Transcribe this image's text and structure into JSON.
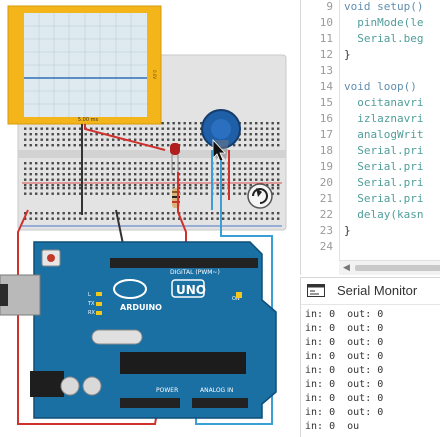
{
  "editor": {
    "lines": [
      {
        "num": "9",
        "text": "void setup()",
        "type": "kw"
      },
      {
        "num": "10",
        "text": "  pinMode(le",
        "type": "fn"
      },
      {
        "num": "11",
        "text": "  Serial.beg",
        "type": "fn"
      },
      {
        "num": "12",
        "text": "}",
        "type": "plain"
      },
      {
        "num": "13",
        "text": "",
        "type": "plain"
      },
      {
        "num": "14",
        "text": "void loop()",
        "type": "kw"
      },
      {
        "num": "15",
        "text": "  ocitanavri",
        "type": "fn"
      },
      {
        "num": "16",
        "text": "  izlaznavri",
        "type": "fn"
      },
      {
        "num": "17",
        "text": "  analogWrit",
        "type": "fn"
      },
      {
        "num": "18",
        "text": "  Serial.pri",
        "type": "fn"
      },
      {
        "num": "19",
        "text": "  Serial.pri",
        "type": "fn"
      },
      {
        "num": "20",
        "text": "  Serial.pri",
        "type": "fn"
      },
      {
        "num": "21",
        "text": "  Serial.pri",
        "type": "fn"
      },
      {
        "num": "22",
        "text": "  delay(kasn",
        "type": "fn"
      },
      {
        "num": "23",
        "text": "}",
        "type": "plain"
      },
      {
        "num": "24",
        "text": "",
        "type": "plain"
      }
    ]
  },
  "serial_monitor": {
    "title": "Serial Monitor",
    "lines": [
      "in: 0  out: 0",
      "in: 0  out: 0",
      "in: 0  out: 0",
      "in: 0  out: 0",
      "in: 0  out: 0",
      "in: 0  out: 0",
      "in: 0  out: 0",
      "in: 0  out: 0",
      "in: 0  ou"
    ]
  },
  "circuit": {
    "oscilloscope_label": "5.00 ms",
    "oscilloscope_side_label": "0.0V",
    "board_brand": "ARDUINO",
    "board_model": "UNO",
    "digital_label": "DIGITAL (PWM~)",
    "power_label": "POWER",
    "analog_label": "ANALOG IN",
    "tx_label": "TX",
    "rx_label": "RX",
    "l_label": "L",
    "on_label": "ON",
    "colors": {
      "board": "#1a6fa3",
      "breadboard": "#e3e3e3",
      "scope_frame": "#f3b51a",
      "scope_screen": "#dfeaf0",
      "wire_red": "#d0312d",
      "wire_blue": "#3a9fd4",
      "wire_dark": "#333333"
    }
  }
}
